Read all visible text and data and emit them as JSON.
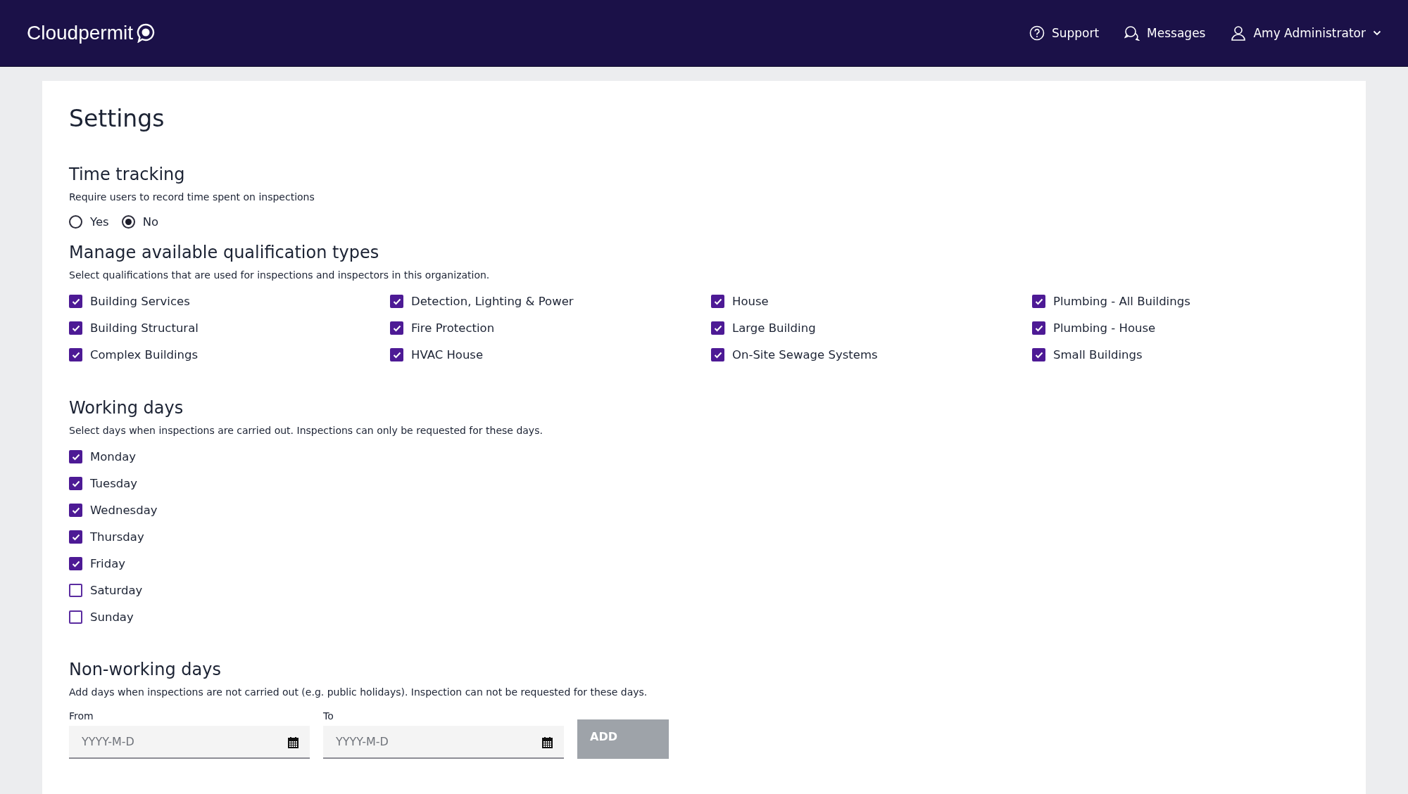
{
  "header": {
    "logo": "Cloudpermit",
    "nav": [
      {
        "kind": "support",
        "label": "Support"
      },
      {
        "kind": "messages",
        "label": "Messages"
      },
      {
        "kind": "user",
        "label": "Amy Administrator"
      }
    ]
  },
  "page_title": "Settings",
  "time_tracking": {
    "title": "Time tracking",
    "description": "Require users to record time spent on inspections",
    "options": [
      {
        "label": "Yes",
        "selected": false
      },
      {
        "label": "No",
        "selected": true
      }
    ]
  },
  "qualifications": {
    "title": "Manage available qualification types",
    "description": "Select qualifications that are used for inspections and inspectors in this organization.",
    "columns": [
      [
        {
          "label": "Building Services",
          "checked": true
        },
        {
          "label": "Building Structural",
          "checked": true
        },
        {
          "label": "Complex Buildings",
          "checked": true
        }
      ],
      [
        {
          "label": "Detection, Lighting & Power",
          "checked": true
        },
        {
          "label": "Fire Protection",
          "checked": true
        },
        {
          "label": "HVAC House",
          "checked": true
        }
      ],
      [
        {
          "label": "House",
          "checked": true
        },
        {
          "label": "Large Building",
          "checked": true
        },
        {
          "label": "On-Site Sewage Systems",
          "checked": true
        }
      ],
      [
        {
          "label": "Plumbing - All Buildings",
          "checked": true
        },
        {
          "label": "Plumbing - House",
          "checked": true
        },
        {
          "label": "Small Buildings",
          "checked": true
        }
      ]
    ]
  },
  "working_days": {
    "title": "Working days",
    "description": "Select days when inspections are carried out. Inspections can only be requested for these days.",
    "days": [
      {
        "label": "Monday",
        "checked": true
      },
      {
        "label": "Tuesday",
        "checked": true
      },
      {
        "label": "Wednesday",
        "checked": true
      },
      {
        "label": "Thursday",
        "checked": true
      },
      {
        "label": "Friday",
        "checked": true
      },
      {
        "label": "Saturday",
        "checked": false
      },
      {
        "label": "Sunday",
        "checked": false
      }
    ]
  },
  "non_working_days": {
    "title": "Non-working days",
    "description": "Add days when inspections are not carried out (e.g. public holidays). Inspection can not be requested for these days.",
    "fields": [
      {
        "label": "From",
        "placeholder": "YYYY-M-D"
      },
      {
        "label": "To",
        "placeholder": "YYYY-M-D"
      }
    ],
    "add_button": {
      "label": "ADD",
      "disabled": true
    }
  }
}
